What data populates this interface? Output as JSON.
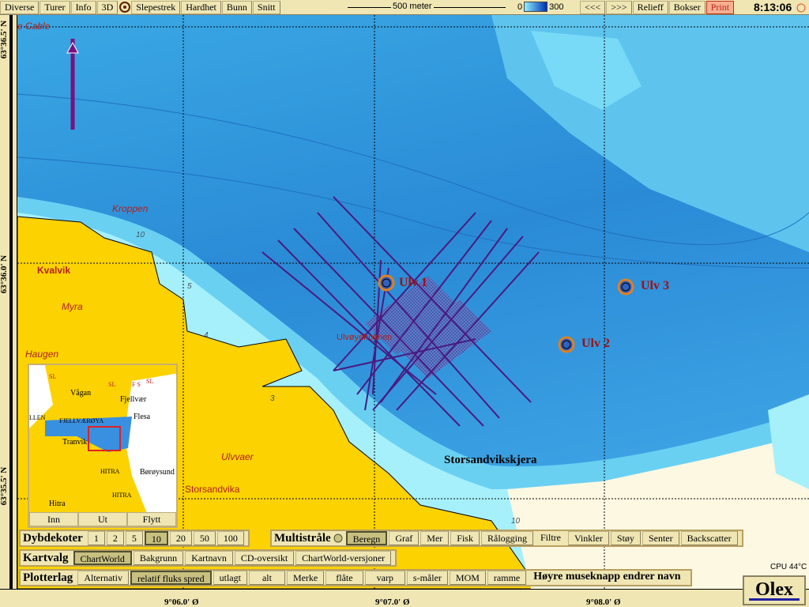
{
  "toolbar": {
    "buttons": [
      "Diverse",
      "Turer",
      "Info",
      "3D",
      "Slepestrek",
      "Hardhet",
      "Bunn",
      "Snitt"
    ],
    "scale_label": "500 meter",
    "depth_min": "0",
    "depth_max": "300",
    "prev": "<<<",
    "next": ">>>",
    "relieff": "Relieff",
    "bokser": "Bokser",
    "print": "Print",
    "clock": "8:13:06"
  },
  "axes": {
    "lat": [
      "63°36.5' N",
      "63°36.0' N",
      "63°35.5' N"
    ],
    "lon": [
      "9°06.0' Ø",
      "9°07.0' Ø",
      "9°08.0' Ø"
    ]
  },
  "map": {
    "labels": {
      "cable": "e Cable",
      "kroppen": "Kroppen",
      "kvalvik": "Kvalvik",
      "myra": "Myra",
      "haugen": "Haugen",
      "ulvvaer": "Ulvvaer",
      "storsandvika": "Storsandvika",
      "storsandvikskjera": "Storsandvikskjera",
      "ulvoyholmen": "Ulvøyeholmen"
    },
    "depths": [
      "5",
      "4",
      "3",
      "10",
      "10"
    ],
    "markers": [
      {
        "label": "Ulv 1"
      },
      {
        "label": "Ulv 2"
      },
      {
        "label": "Ulv 3"
      }
    ]
  },
  "minimap": {
    "labels": [
      "Vågan",
      "Fjellvær",
      "Flesa",
      "FJELLVÆRØYA",
      "LLEN",
      "Tranvik",
      "HITRA",
      "Børøysund",
      "HITRA",
      "Hitra",
      "SL",
      "SL",
      "F S",
      "SL"
    ],
    "buttons": [
      "Inn",
      "Ut",
      "Flytt"
    ]
  },
  "dybdekoter": {
    "label": "Dybdekoter",
    "values": [
      "1",
      "2",
      "5",
      "10",
      "20",
      "50",
      "100"
    ],
    "selected": "10"
  },
  "multistraale": {
    "label": "Multistråle",
    "buttons": [
      "Beregn",
      "Graf",
      "Mer",
      "Fisk",
      "Rålogging",
      "Filtre",
      "Vinkler",
      "Støy",
      "Senter",
      "Backscatter"
    ],
    "selected": "Beregn"
  },
  "kartvalg": {
    "label": "Kartvalg",
    "buttons": [
      "ChartWorld",
      "Bakgrunn",
      "Kartnavn",
      "CD-oversikt",
      "ChartWorld-versjoner"
    ],
    "selected": "ChartWorld"
  },
  "plotterlag": {
    "label": "Plotterlag",
    "buttons": [
      "Alternativ",
      "relatif fluks spred",
      "utlagt",
      "alt",
      "Merke",
      "flåte",
      "varp",
      "s-måler",
      "MOM",
      "ramme"
    ],
    "selected": "relatif fluks spred",
    "hint": "Høyre museknapp endrer navn"
  },
  "status": {
    "cpu": "CPU 44°C",
    "logo": "Olex"
  },
  "colors": {
    "land": "#fcd200",
    "deep": "#2a8ad6",
    "shallow": "#8ee8fa",
    "track": "#4a1a80",
    "marker": "#e08020",
    "panel": "#efe6b4"
  }
}
